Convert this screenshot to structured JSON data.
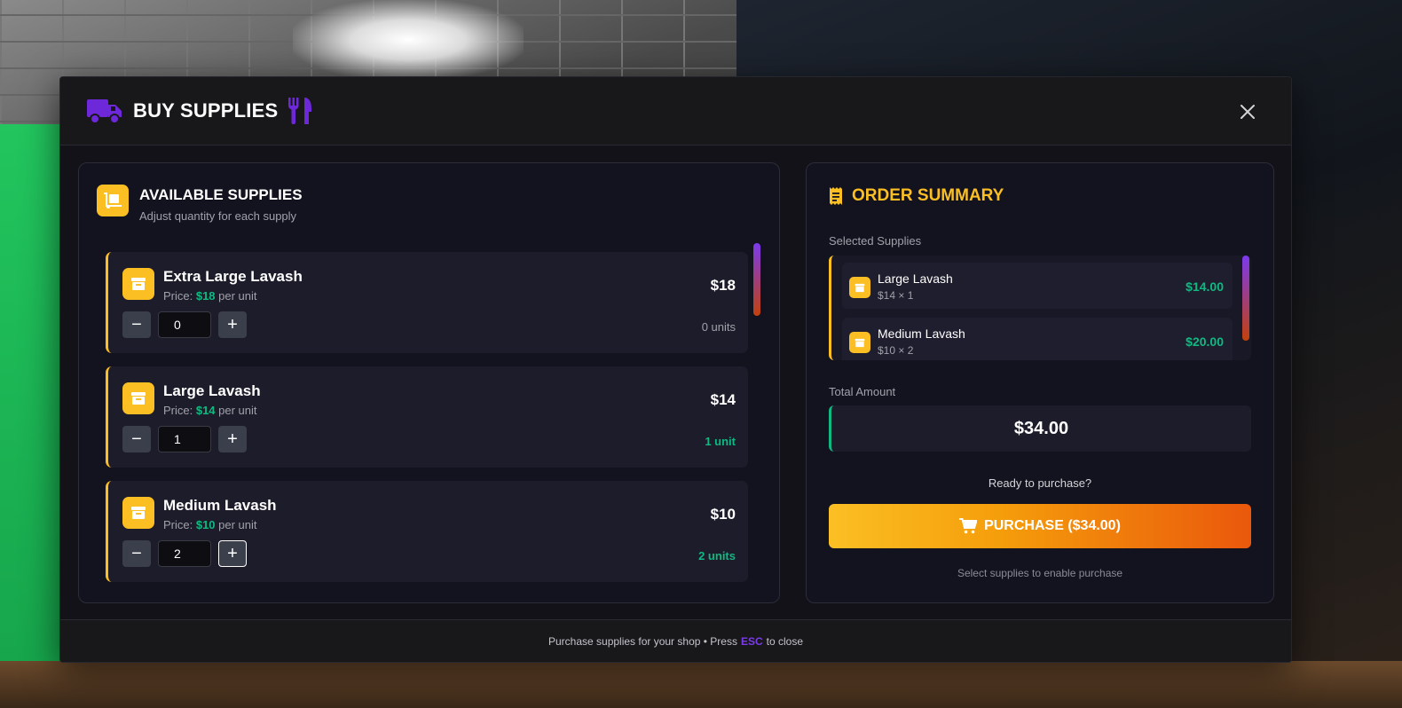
{
  "header": {
    "title": "BUY SUPPLIES",
    "truck_icon": "truck-icon",
    "utensils_icon": "utensils-icon",
    "accent": "#6d28d9"
  },
  "available": {
    "title": "AVAILABLE SUPPLIES",
    "subtitle": "Adjust quantity for each supply",
    "price_prefix": "Price: ",
    "price_suffix": " per unit",
    "items": [
      {
        "name": "Extra Large Lavash",
        "unit_price": "$18",
        "price": "$18",
        "qty": "0",
        "units": "0 units"
      },
      {
        "name": "Large Lavash",
        "unit_price": "$14",
        "price": "$14",
        "qty": "1",
        "units": "1 unit"
      },
      {
        "name": "Medium Lavash",
        "unit_price": "$10",
        "price": "$10",
        "qty": "2",
        "units": "2 units"
      }
    ]
  },
  "summary": {
    "title": "ORDER SUMMARY",
    "selected_label": "Selected Supplies",
    "selected": [
      {
        "name": "Large Lavash",
        "calc": "$14 × 1",
        "total": "$14.00"
      },
      {
        "name": "Medium Lavash",
        "calc": "$10 × 2",
        "total": "$20.00"
      }
    ],
    "total_label": "Total Amount",
    "total": "$34.00",
    "ready_text": "Ready to purchase?",
    "purchase_label": "PURCHASE ($34.00)",
    "hint": "Select supplies to enable purchase"
  },
  "footer": {
    "pre": "Purchase supplies for your shop • Press",
    "key": "ESC",
    "post": "to close"
  },
  "colors": {
    "accent_purple": "#7c3aed",
    "accent_yellow": "#fbbf24",
    "accent_green": "#10b981",
    "accent_orange": "#ea580c"
  }
}
